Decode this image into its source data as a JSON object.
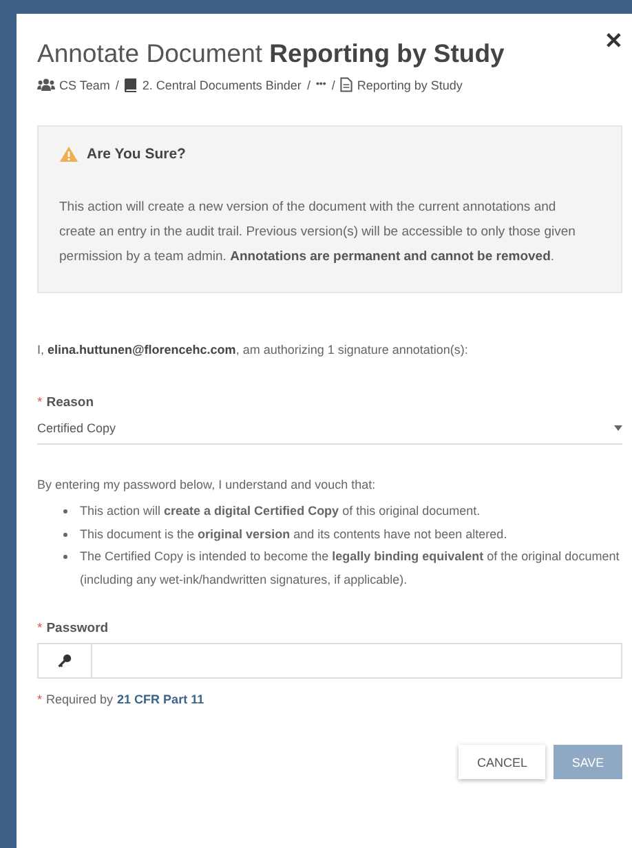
{
  "dialog": {
    "title": "Annotate Document",
    "title_bold": "Reporting by Study",
    "close": "✕",
    "breadcrumb": [
      {
        "kind": "team",
        "label": "CS Team"
      },
      {
        "kind": "binder",
        "label": "2. Central Documents Binder",
        "separator": "/"
      },
      {
        "kind": "more",
        "label": "•••",
        "separator": "/"
      },
      {
        "kind": "document",
        "label": "Reporting by Study",
        "separator": "/"
      }
    ]
  },
  "alert": {
    "title": "Are You Sure?",
    "text": "This action will create a new version of the document with the current annotations and create an entry in the audit trail. Previous version(s) will be accessible to only those given permission by a team admin. **Annotations are permanent and cannot be removed**."
  },
  "authorization": "I, **elina.huttunen@florencehc.com**, am authorizing 1 signature annotation(s):",
  "reason": {
    "required_mark": "*",
    "label": "Reason",
    "value": "Certified Copy"
  },
  "vouch": {
    "intro": "By entering my password below, I understand and vouch that:",
    "items": [
      "This action will **create a digital Certified Copy** of this original document.",
      "This document is the **original version** and its contents have not been altered.",
      "The Certified Copy is intended to become the **legally binding equivalent** of the original document (including any wet-ink/handwritten signatures, if applicable)."
    ]
  },
  "password": {
    "required_mark": "*",
    "label": "Password"
  },
  "requirement": {
    "mark": "*",
    "text": "Required by",
    "link": "21 CFR Part 11"
  },
  "buttons": [
    {
      "label": "CANCEL",
      "kind": "secondary",
      "disabled": false
    },
    {
      "label": "SAVE",
      "kind": "primary",
      "disabled": true
    }
  ]
}
